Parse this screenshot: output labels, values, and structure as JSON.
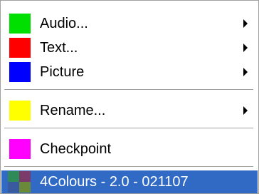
{
  "menu": {
    "items": [
      {
        "label": "Audio...",
        "color": "#00e000",
        "submenu": true
      },
      {
        "label": "Text...",
        "color": "#ff0000",
        "submenu": true
      },
      {
        "label": "Picture",
        "color": "#0000ff",
        "submenu": true
      },
      {
        "label": "Rename...",
        "color": "#ffff00",
        "submenu": true
      },
      {
        "label": "Checkpoint",
        "color": "#ff00ff",
        "submenu": false
      }
    ],
    "footer": {
      "label": "4Colours - 2.0 - 021107",
      "icon": "four-colours-app-icon",
      "highlight_color": "#316ac5"
    }
  }
}
